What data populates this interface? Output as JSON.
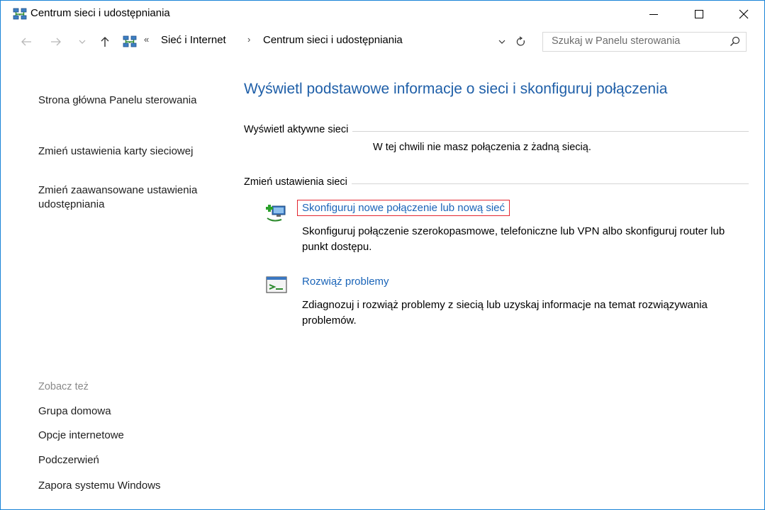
{
  "window": {
    "title": "Centrum sieci i udostępniania",
    "accent_color": "#1883d7"
  },
  "nav": {
    "back_icon": "arrow-left-icon",
    "forward_icon": "arrow-right-icon",
    "recent_icon": "chevron-down-icon",
    "up_icon": "arrow-up-icon",
    "address_prefix": "«",
    "breadcrumbs": [
      "Sieć i Internet",
      "Centrum sieci i udostępniania"
    ],
    "separator": "›",
    "search_placeholder": "Szukaj w Panelu sterowania"
  },
  "sidebar": {
    "links": [
      "Strona główna Panelu sterowania",
      "Zmień ustawienia karty sieciowej",
      "Zmień zaawansowane ustawienia udostępniania"
    ],
    "see_also_heading": "Zobacz też",
    "see_also": [
      "Grupa domowa",
      "Opcje internetowe",
      "Podczerwień",
      "Zapora systemu Windows"
    ]
  },
  "main": {
    "title": "Wyświetl podstawowe informacje o sieci i skonfiguruj połączenia",
    "active_networks_label": "Wyświetl aktywne sieci",
    "no_connection_text": "W tej chwili nie masz połączenia z żadną siecią.",
    "change_settings_label": "Zmień ustawienia sieci",
    "tasks": [
      {
        "icon": "new-connection-icon",
        "link": "Skonfiguruj nowe połączenie lub nową sieć",
        "description": "Skonfiguruj połączenie szerokopasmowe, telefoniczne lub VPN albo skonfiguruj router lub punkt dostępu.",
        "highlighted": true
      },
      {
        "icon": "troubleshoot-icon",
        "link": "Rozwiąż problemy",
        "description": "Zdiagnozuj i rozwiąż problemy z siecią lub uzyskaj informacje na temat rozwiązywania problemów.",
        "highlighted": false
      }
    ],
    "link_color": "#1a64b8",
    "title_color": "#1f5fa8",
    "highlight_color": "#e3252f"
  }
}
